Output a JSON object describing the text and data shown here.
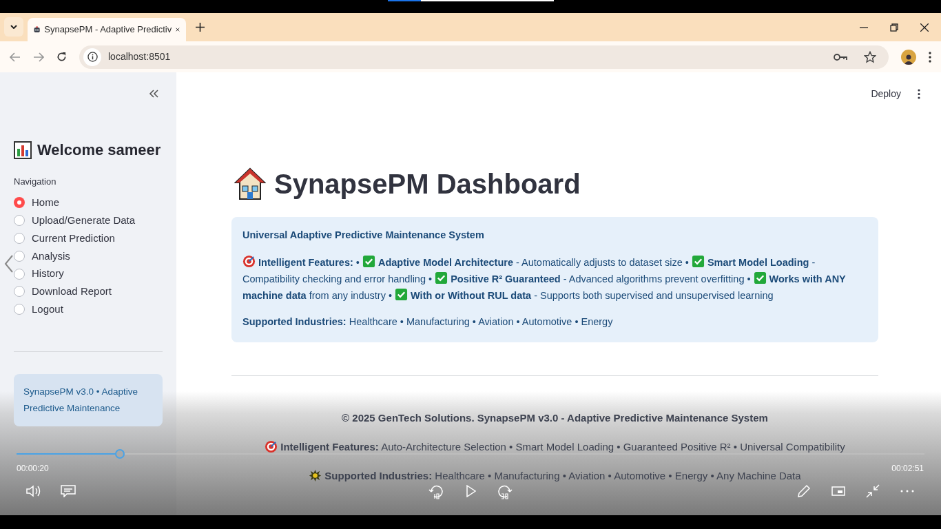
{
  "browser": {
    "tab_title": "SynapsePM - Adaptive Predictiv",
    "url": "localhost:8501"
  },
  "sidebar": {
    "title": "Welcome sameer",
    "nav_label": "Navigation",
    "items": [
      {
        "label": "Home",
        "selected": true
      },
      {
        "label": "Upload/Generate Data",
        "selected": false
      },
      {
        "label": "Current Prediction",
        "selected": false
      },
      {
        "label": "Analysis",
        "selected": false
      },
      {
        "label": "History",
        "selected": false
      },
      {
        "label": "Download Report",
        "selected": false
      },
      {
        "label": "Logout",
        "selected": false
      }
    ],
    "footer_note": "SynapsePM v3.0 • Adaptive Predictive Maintenance"
  },
  "header": {
    "deploy": "Deploy"
  },
  "main": {
    "title": "SynapsePM Dashboard",
    "info": {
      "heading": "Universal Adaptive Predictive Maintenance System",
      "features": [
        {
          "kind": "target",
          "text": "**Intelligent Features:** •"
        },
        {
          "kind": "check",
          "text": "**Adaptive Model Architecture** - Automatically adjusts to dataset size •"
        },
        {
          "kind": "check",
          "text": "**Smart Model Loading** - Compatibility checking and error handling •"
        },
        {
          "kind": "check",
          "text": "**Positive R² Guaranteed** - Advanced algorithms prevent overfitting •"
        },
        {
          "kind": "check",
          "text": "**Works with ANY machine data** from any industry •"
        },
        {
          "kind": "check",
          "text": "**With or Without RUL data** - Supports both supervised and unsupervised learning"
        }
      ],
      "industries": "**Supported Industries:** Healthcare • Manufacturing • Aviation • Automotive • Energy"
    },
    "footer": [
      {
        "kind": "plain",
        "text": "© 2025 GenTech Solutions. SynapsePM v3.0 - Adaptive Predictive Maintenance System"
      },
      {
        "kind": "target",
        "text": "**Intelligent Features:** Auto-Architecture Selection • Smart Model Loading • Guaranteed Positive R² • Universal Compatibility"
      },
      {
        "kind": "star",
        "text": "**Supported Industries:** Healthcare • Manufacturing • Aviation • Automotive • Energy • Any Machine Data"
      }
    ]
  },
  "player": {
    "level": 0.114,
    "elapsed": "00:00:20",
    "total": "00:02:51"
  }
}
